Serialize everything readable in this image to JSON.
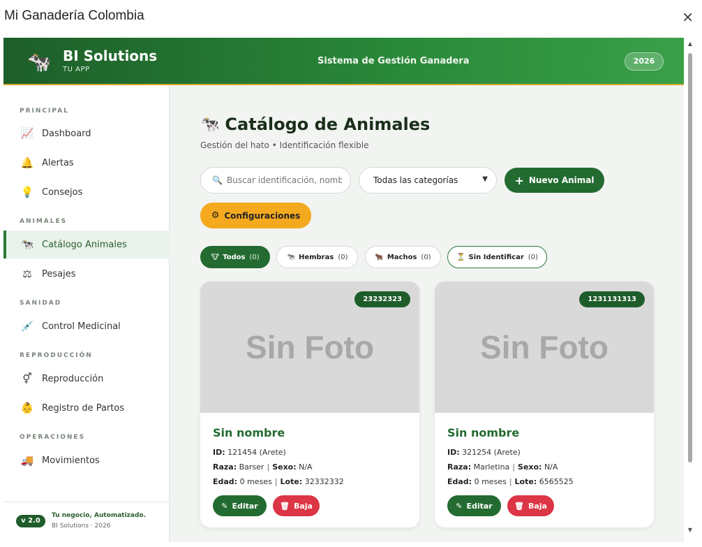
{
  "window": {
    "title": "Mi Ganadería Colombia",
    "close_glyph": "×"
  },
  "header": {
    "brand_icon": "🐄",
    "brand_name": "BI Solutions",
    "brand_sub": "TU APP",
    "center_title": "Sistema de Gestión Ganadera",
    "year": "2026",
    "gradient_colors": [
      "#1d5e29",
      "#3aa048"
    ]
  },
  "sidebar": {
    "sections": [
      {
        "title": "PRINCIPAL",
        "items": [
          {
            "label": "Dashboard",
            "icon": "chart-line-icon",
            "glyph": "📈"
          },
          {
            "label": "Alertas",
            "icon": "bell-icon",
            "glyph": "🔔"
          },
          {
            "label": "Consejos",
            "icon": "lightbulb-icon",
            "glyph": "💡"
          }
        ]
      },
      {
        "title": "ANIMALES",
        "items": [
          {
            "label": "Catálogo Animales",
            "icon": "cow-icon",
            "glyph": "🐄",
            "active": true
          },
          {
            "label": "Pesajes",
            "icon": "weight-icon",
            "glyph": "⚖"
          }
        ]
      },
      {
        "title": "SANIDAD",
        "items": [
          {
            "label": "Control Medicinal",
            "icon": "syringe-icon",
            "glyph": "💉"
          }
        ]
      },
      {
        "title": "REPRODUCCIÓN",
        "items": [
          {
            "label": "Reproducción",
            "icon": "venus-mars-icon",
            "glyph": "⚥"
          },
          {
            "label": "Registro de Partos",
            "icon": "baby-icon",
            "glyph": "👶"
          }
        ]
      },
      {
        "title": "OPERACIONES",
        "items": [
          {
            "label": "Movimientos",
            "icon": "truck-icon",
            "glyph": "🚚"
          }
        ]
      }
    ],
    "footer": {
      "version": "v 2.0",
      "tagline": "Tu negocio, Automatizado.",
      "copyright": "BI Solutions · 2026"
    }
  },
  "main": {
    "title_icon": "🐄",
    "title": "Catálogo de Animales",
    "subtitle": "Gestión del hato • Identificación flexible",
    "search": {
      "placeholder": "Buscar identificación, nombre",
      "icon": "search-icon",
      "glyph": "🔍"
    },
    "category_select": {
      "value": "Todas las categorías"
    },
    "new_button": {
      "label": "Nuevo Animal",
      "glyph": "+"
    },
    "config_button": {
      "label": "Configuraciones",
      "glyph": "⚙"
    },
    "filters": [
      {
        "label": "Todos",
        "count": "(0)",
        "glyph": "🐮",
        "active": true
      },
      {
        "label": "Hembras",
        "count": "(0)",
        "glyph": "🐄"
      },
      {
        "label": "Machos",
        "count": "(0)",
        "glyph": "🐂"
      },
      {
        "label": "Sin Identificar",
        "count": "(0)",
        "glyph": "⏳",
        "outlined": true
      }
    ],
    "cards": [
      {
        "badge": "23232323",
        "photo_text": "Sin Foto",
        "name": "Sin nombre",
        "id_label": "ID:",
        "id_value": "121454 (Arete)",
        "raza_label": "Raza:",
        "raza_value": "Barser",
        "sexo_label": "Sexo:",
        "sexo_value": "N/A",
        "edad_label": "Edad:",
        "edad_value": "0 meses",
        "lote_label": "Lote:",
        "lote_value": "32332332",
        "edit_label": "Editar",
        "delete_label": "Baja"
      },
      {
        "badge": "1231131313",
        "photo_text": "Sin Foto",
        "name": "Sin nombre",
        "id_label": "ID:",
        "id_value": "321254 (Arete)",
        "raza_label": "Raza:",
        "raza_value": "Marletina",
        "sexo_label": "Sexo:",
        "sexo_value": "N/A",
        "edad_label": "Edad:",
        "edad_value": "0 meses",
        "lote_label": "Lote:",
        "lote_value": "6565525",
        "edit_label": "Editar",
        "delete_label": "Baja"
      }
    ]
  },
  "colors": {
    "primary": "#236b31",
    "accent": "#f4a91f",
    "danger": "#dc3545",
    "gold_border": "#d4a72c"
  }
}
